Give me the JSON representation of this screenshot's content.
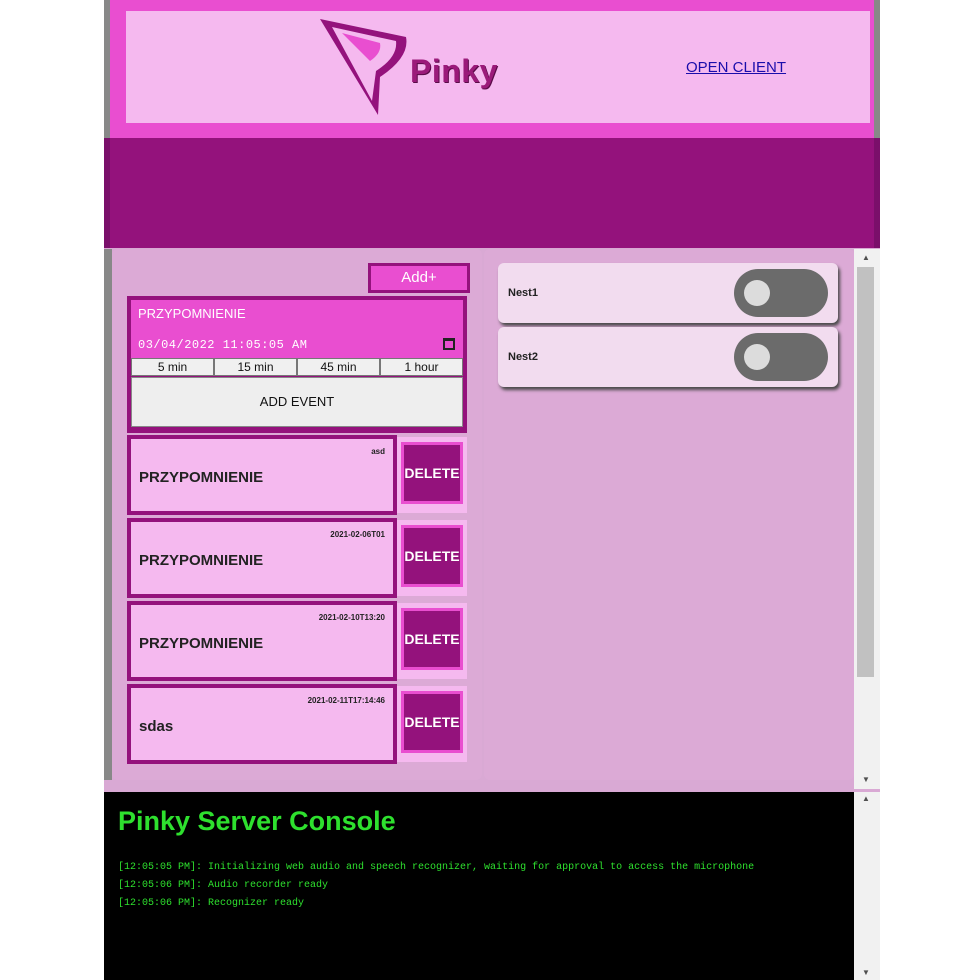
{
  "header": {
    "logo_text": "Pinky",
    "open_client_label": "OPEN CLIENT"
  },
  "reminders": {
    "add_label": "Add+",
    "new_event": {
      "title": "PRZYPOMNIENIE",
      "datetime": "03/04/2022 11:05:05 AM",
      "quick_times": [
        "5 min",
        "15 min",
        "45 min",
        "1 hour"
      ],
      "add_event_label": "ADD EVENT"
    },
    "delete_label": "DELETE",
    "events": [
      {
        "title": "PRZYPOMNIENIE",
        "meta": "asd"
      },
      {
        "title": "PRZYPOMNIENIE",
        "meta": "2021-02-06T01"
      },
      {
        "title": "PRZYPOMNIENIE",
        "meta": "2021-02-10T13:20"
      },
      {
        "title": "sdas",
        "meta": "2021-02-11T17:14:46"
      }
    ]
  },
  "devices": [
    {
      "label": "Nest1",
      "on": false
    },
    {
      "label": "Nest2",
      "on": false
    }
  ],
  "console": {
    "title": "Pinky Server Console",
    "lines": [
      "[12:05:05 PM]: Initializing web audio and speech recognizer, waiting for approval to access the microphone",
      "[12:05:06 PM]: Audio recorder ready",
      "[12:05:06 PM]: Recognizer ready"
    ]
  },
  "colors": {
    "accent": "#e94ed0",
    "dark_magenta": "#94127c",
    "panel": "#dcaad6",
    "console_text": "#2ee02e"
  }
}
